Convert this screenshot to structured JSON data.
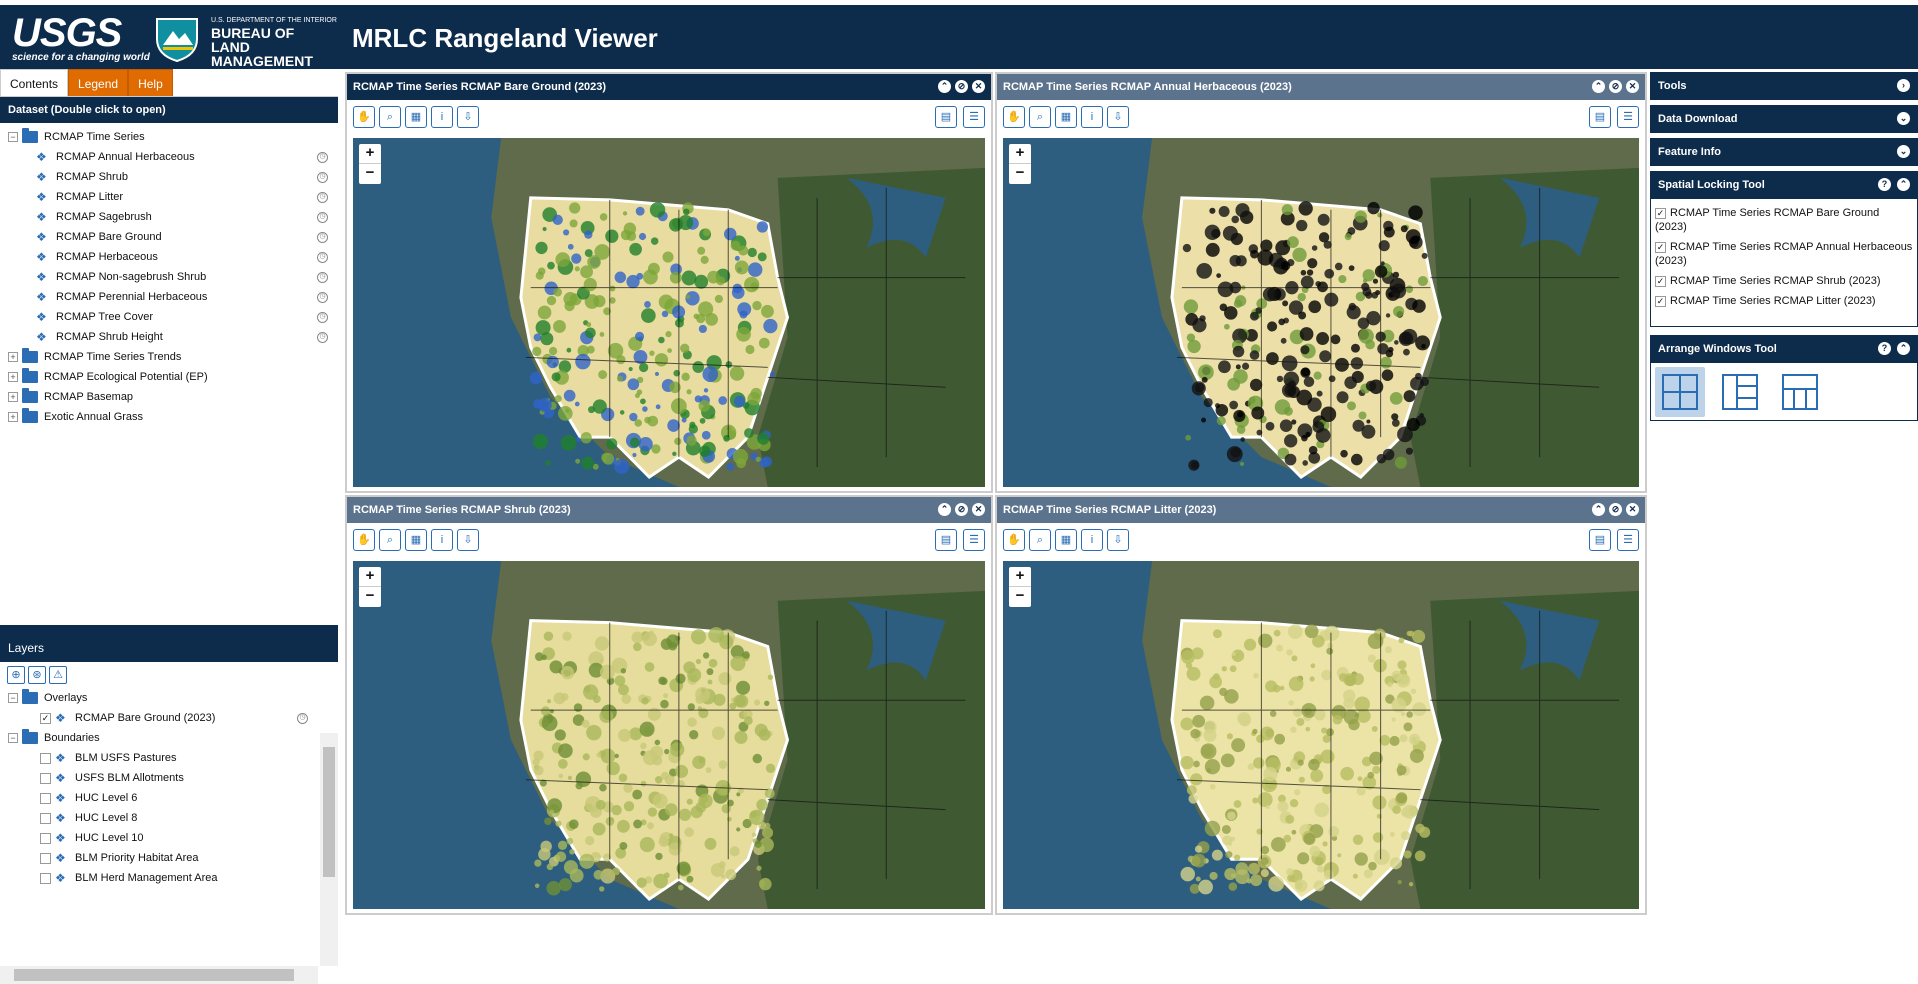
{
  "header": {
    "usgs_logo": "USGS",
    "usgs_tagline": "science for a changing world",
    "dept": "U.S. DEPARTMENT OF THE INTERIOR",
    "bureau": "BUREAU OF LAND MANAGEMENT",
    "title": "MRLC Rangeland Viewer"
  },
  "tabs": [
    "Contents",
    "Legend",
    "Help"
  ],
  "dataset_header": "Dataset (Double click to open)",
  "tree": {
    "root": "RCMAP Time Series",
    "children": [
      "RCMAP Annual Herbaceous",
      "RCMAP Shrub",
      "RCMAP Litter",
      "RCMAP Sagebrush",
      "RCMAP Bare Ground",
      "RCMAP Herbaceous",
      "RCMAP Non-sagebrush Shrub",
      "RCMAP Perennial Herbaceous",
      "RCMAP Tree Cover",
      "RCMAP Shrub Height"
    ],
    "folders": [
      "RCMAP Time Series Trends",
      "RCMAP Ecological Potential (EP)",
      "RCMAP Basemap",
      "Exotic Annual Grass"
    ]
  },
  "layers": {
    "header": "Layers",
    "overlays_label": "Overlays",
    "overlay_item": "RCMAP Bare Ground (2023)",
    "boundaries_label": "Boundaries",
    "boundaries": [
      "BLM USFS Pastures",
      "USFS BLM Allotments",
      "HUC Level 6",
      "HUC Level 8",
      "HUC Level 10",
      "BLM Priority Habitat Area",
      "BLM Herd Management Area"
    ]
  },
  "panels": [
    {
      "title": "RCMAP Time Series RCMAP Bare Ground (2023)",
      "active": true,
      "palette": "bare"
    },
    {
      "title": "RCMAP Time Series RCMAP Annual Herbaceous (2023)",
      "active": false,
      "palette": "herb"
    },
    {
      "title": "RCMAP Time Series RCMAP Shrub (2023)",
      "active": false,
      "palette": "shrub"
    },
    {
      "title": "RCMAP Time Series RCMAP Litter (2023)",
      "active": false,
      "palette": "litter"
    }
  ],
  "zoom": {
    "in": "+",
    "out": "−"
  },
  "right": {
    "tools": "Tools",
    "data_download": "Data Download",
    "feature_info": "Feature Info",
    "spatial_locking": "Spatial Locking Tool",
    "lock_items": [
      "RCMAP Time Series RCMAP Bare Ground (2023)",
      "RCMAP Time Series RCMAP Annual Herbaceous (2023)",
      "RCMAP Time Series RCMAP Shrub (2023)",
      "RCMAP Time Series RCMAP Litter (2023)"
    ],
    "arrange": "Arrange Windows Tool"
  },
  "colors": {
    "navy": "#0d2b4b",
    "orange": "#e06b00",
    "accent": "#2a6db5"
  }
}
